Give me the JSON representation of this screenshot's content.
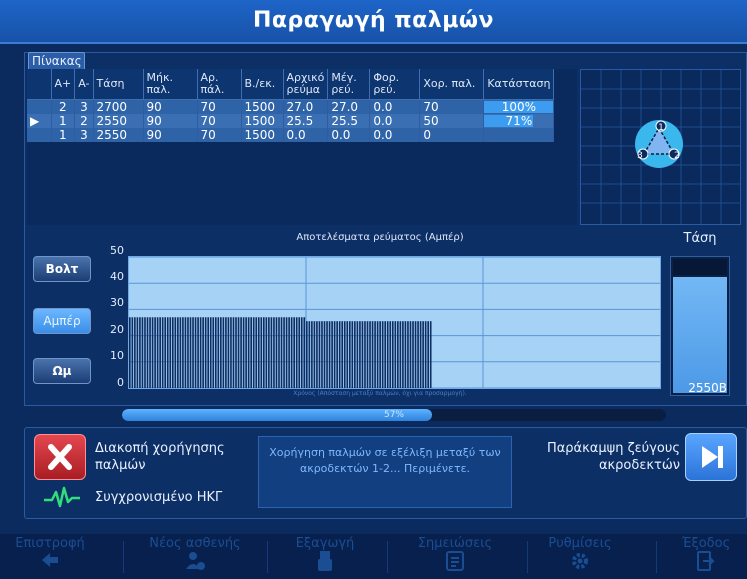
{
  "title": "Παραγωγή παλμών",
  "tab_label": "Πίνακας",
  "table": {
    "headers": [
      "",
      "A+",
      "A-",
      "Τάση",
      "Μήκ. παλ.",
      "Αρ. πάλ.",
      "Β./εκ.",
      "Αρχικό ρεύμα",
      "Μέγ. ρεύ.",
      "Φορ. ρεύ.",
      "Χορ. παλ.",
      "Κατάσταση"
    ],
    "rows": [
      {
        "marker": "",
        "a_plus": "2",
        "a_minus": "3",
        "voltage": "2700",
        "pulse_len": "90",
        "pulse_count": "70",
        "steps": "1500",
        "initial_current": "27.0",
        "max_current": "27.0",
        "charge": "0.0",
        "delivered": "70",
        "status": "100%",
        "status_fraction": 1.0
      },
      {
        "marker": "▶",
        "a_plus": "1",
        "a_minus": "2",
        "voltage": "2550",
        "pulse_len": "90",
        "pulse_count": "70",
        "steps": "1500",
        "initial_current": "25.5",
        "max_current": "25.5",
        "charge": "0.0",
        "delivered": "50",
        "status": "71%",
        "status_fraction": 0.71
      },
      {
        "marker": "",
        "a_plus": "1",
        "a_minus": "3",
        "voltage": "2550",
        "pulse_len": "90",
        "pulse_count": "70",
        "steps": "1500",
        "initial_current": "0.0",
        "max_current": "0.0",
        "charge": "0.0",
        "delivered": "0",
        "status": "",
        "status_fraction": 0
      }
    ]
  },
  "diagram": {
    "electrodes": [
      "1",
      "2",
      "3"
    ]
  },
  "units": {
    "volt": "Βολτ",
    "amp": "Αμπέρ",
    "ohm": "Ωμ"
  },
  "chart_data": {
    "type": "bar",
    "title": "Αποτελέσματα ρεύματος (Αμπέρ)",
    "xlabel": "Χρόνος (Απόσταση μεταξύ παλμών, όχι για προσαρμογή).",
    "ylabel": "",
    "yticks": [
      "0",
      "10",
      "20",
      "30",
      "40",
      "50"
    ],
    "ylim": [
      0,
      50
    ],
    "series": [
      {
        "bars": 70,
        "value": 27.0
      },
      {
        "bars": 50,
        "value": 25.5
      }
    ]
  },
  "voltage": {
    "label": "Τάση",
    "value": "2550B",
    "fraction": 0.87
  },
  "progress": {
    "text": "57%",
    "fraction": 0.57
  },
  "controls": {
    "stop_label": "Διακοπή χορήγησης παλμών",
    "message": "Χορήγηση παλμών σε εξέλιξη μεταξύ των ακροδεκτών 1-2... Περιμένετε.",
    "bypass_label": "Παράκαμψη ζεύγους ακροδεκτών",
    "ecg_label": "Συγχρονισμένο ΗΚΓ"
  },
  "nav": [
    {
      "label": "Επιστροφή",
      "icon": "arrow-left-icon"
    },
    {
      "label": "Νέος ασθενής",
      "icon": "add-user-icon"
    },
    {
      "label": "Εξαγωγή",
      "icon": "usb-icon"
    },
    {
      "label": "Σημειώσεις",
      "icon": "notes-icon"
    },
    {
      "label": "Ρυθμίσεις",
      "icon": "gear-icon"
    },
    {
      "label": "Έξοδος",
      "icon": "exit-icon"
    }
  ],
  "colors": {
    "accent": "#3b9cf0",
    "stop": "#c92d35",
    "bypass": "#3b86e6",
    "plot_bg": "#a6d2f6",
    "bars": "#0d2d63"
  }
}
